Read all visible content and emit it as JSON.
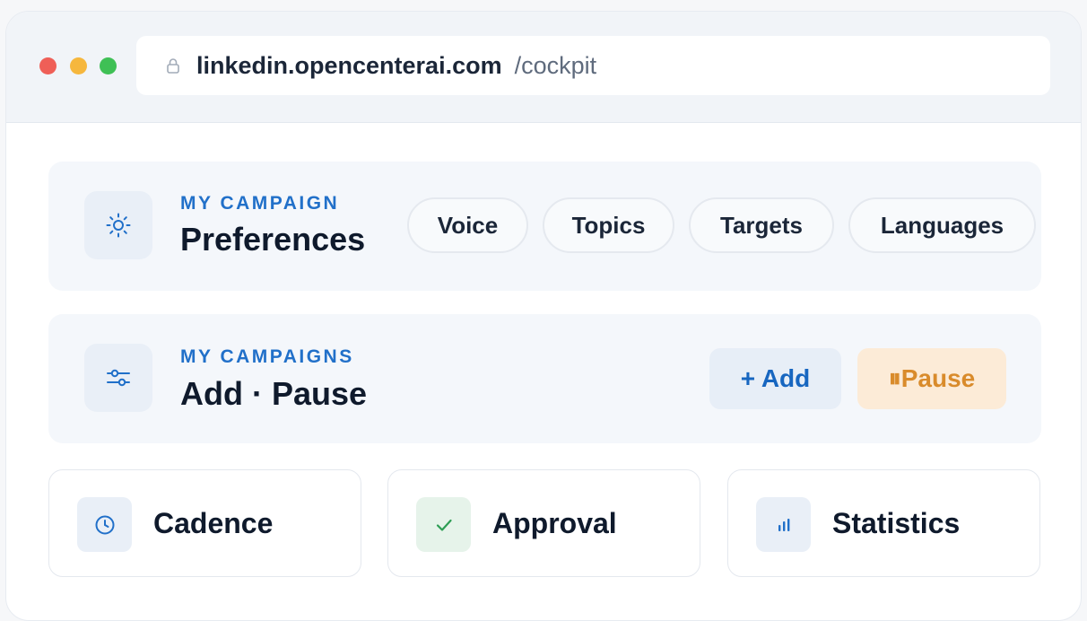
{
  "browser": {
    "url_domain": "linkedin.opencenterai.com",
    "url_path": "/cockpit",
    "traffic_lights": [
      "close",
      "minimize",
      "maximize"
    ]
  },
  "preferences_panel": {
    "kicker": "MY CAMPAIGN",
    "title": "Preferences",
    "icon": "sun-icon",
    "chips": [
      {
        "label": "Voice"
      },
      {
        "label": "Topics"
      },
      {
        "label": "Targets"
      },
      {
        "label": "Languages"
      }
    ]
  },
  "campaigns_panel": {
    "kicker": "MY CAMPAIGNS",
    "title": "Add · Pause",
    "icon": "sliders-icon",
    "add_button": "+ Add",
    "pause_button": "⏸Pause"
  },
  "cards": [
    {
      "label": "Cadence",
      "icon": "clock-icon"
    },
    {
      "label": "Approval",
      "icon": "check-icon"
    },
    {
      "label": "Statistics",
      "icon": "bar-chart-icon"
    }
  ],
  "colors": {
    "accent_blue": "#2170c9",
    "pause_orange": "#d98b2b",
    "approval_green": "#2e9e55"
  }
}
